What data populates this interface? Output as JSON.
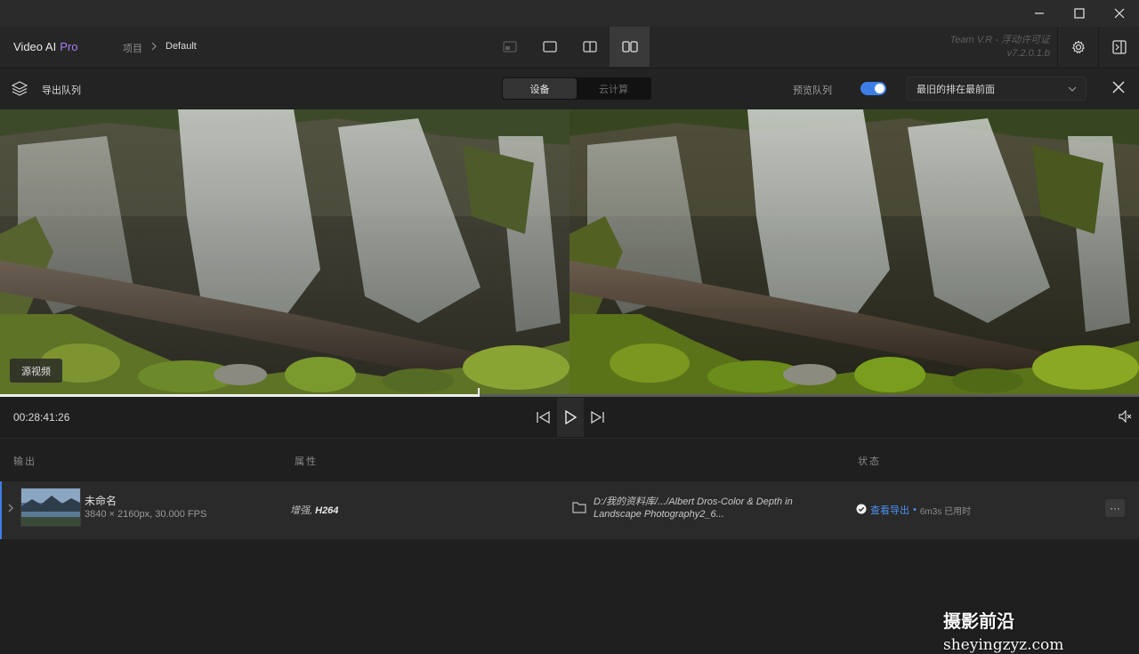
{
  "app": {
    "name": "Video AI",
    "edition": "Pro",
    "breadcrumb": [
      "项目",
      "Default"
    ],
    "license_line1": "Team V.R - 浮动许可证",
    "license_line2": "v7.2.0.1.b"
  },
  "window_controls": [
    "minimize-icon",
    "maximize-icon",
    "close-icon"
  ],
  "view_modes": [
    {
      "name": "single-view-icon",
      "active": false
    },
    {
      "name": "output-only-view-icon",
      "active": false
    },
    {
      "name": "split-view-icon",
      "active": false
    },
    {
      "name": "side-by-side-view-icon",
      "active": true
    }
  ],
  "queue_bar": {
    "title": "导出队列",
    "segments": [
      "设备",
      "云计算"
    ],
    "active_segment": "设备",
    "preview_queue_label": "预览队列",
    "preview_queue_on": true,
    "sort_value": "最旧的排在最前面"
  },
  "preview": {
    "source_label": "源视频"
  },
  "timeline": {
    "time": "00:28:41:26",
    "progress": 0.42
  },
  "table": {
    "headers": {
      "output": "输出",
      "attributes": "属性",
      "status": "状态"
    },
    "rows": [
      {
        "name": "未命名",
        "meta": "3840 × 2160px, 30.000 FPS",
        "attr_prefix": "增强, ",
        "codec": "H264",
        "path": "D:/我的资料库/.../Albert Dros-Color & Depth in Landscape Photography2_6...",
        "status_link": "查看导出",
        "status_sep": "•",
        "duration": "6m3s 已用时",
        "more": "···"
      }
    ]
  },
  "watermark": {
    "cn": "摄影前沿",
    "latin": "sheyingzyz.com"
  },
  "colors": {
    "accent": "#3d7ee6",
    "brand_pro": "#a77ef5",
    "link": "#4a8ff0"
  }
}
